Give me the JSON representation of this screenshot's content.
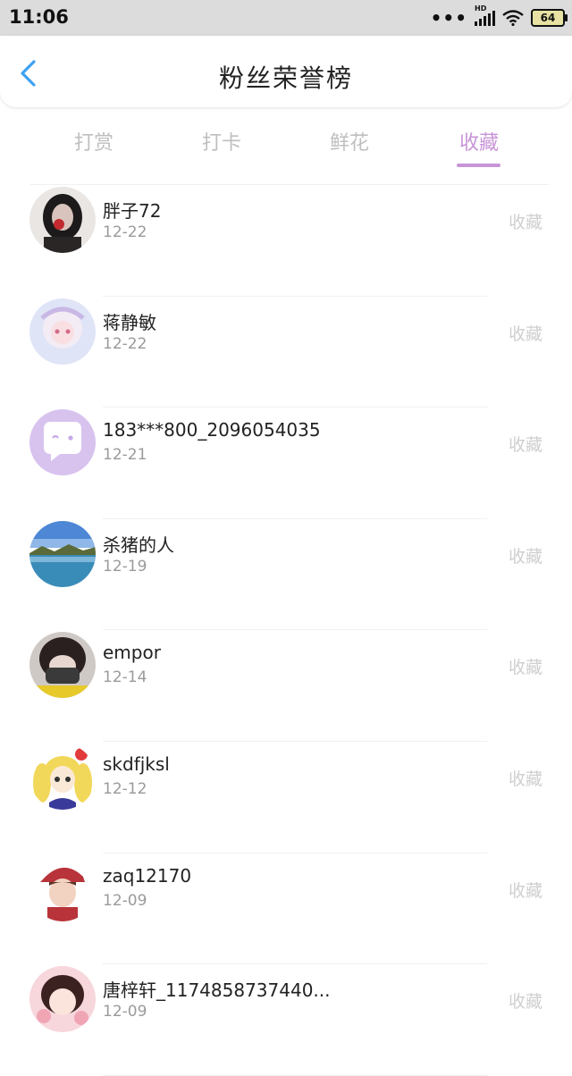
{
  "status_bar": {
    "time": "11:06",
    "dots": "•••",
    "signal_label": "HD",
    "battery": "64"
  },
  "header": {
    "title": "粉丝荣誉榜"
  },
  "tabs": [
    {
      "label": "打赏",
      "active": false
    },
    {
      "label": "打卡",
      "active": false
    },
    {
      "label": "鲜花",
      "active": false
    },
    {
      "label": "收藏",
      "active": true
    }
  ],
  "list": [
    {
      "name": "胖子72",
      "date": "12-22",
      "action": "收藏"
    },
    {
      "name": "蒋静敏",
      "date": "12-22",
      "action": "收藏"
    },
    {
      "name": "183***800_2096054035",
      "date": "12-21",
      "action": "收藏"
    },
    {
      "name": "杀猪的人",
      "date": "12-19",
      "action": "收藏"
    },
    {
      "name": "empor",
      "date": "12-14",
      "action": "收藏"
    },
    {
      "name": "skdfjksl",
      "date": "12-12",
      "action": "收藏"
    },
    {
      "name": "zaq12170",
      "date": "12-09",
      "action": "收藏"
    },
    {
      "name": "唐梓轩_1174858737440...",
      "date": "12-09",
      "action": "收藏"
    }
  ],
  "colors": {
    "accent": "#c894d8",
    "back_arrow": "#3da1f0",
    "inactive_tab": "#bfbfbf"
  }
}
